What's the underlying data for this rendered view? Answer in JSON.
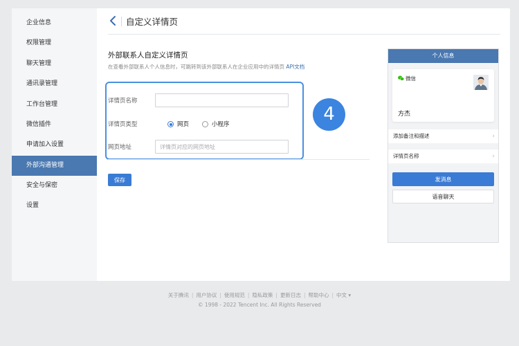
{
  "sidebar": {
    "items": [
      {
        "label": "企业信息"
      },
      {
        "label": "权限管理"
      },
      {
        "label": "聊天管理"
      },
      {
        "label": "通讯录管理"
      },
      {
        "label": "工作台管理"
      },
      {
        "label": "微信插件"
      },
      {
        "label": "申请加入设置"
      },
      {
        "label": "外部沟通管理",
        "active": true
      },
      {
        "label": "安全与保密"
      },
      {
        "label": "设置"
      }
    ]
  },
  "header": {
    "title": "自定义详情页"
  },
  "section": {
    "title": "外部联系人自定义详情页",
    "description": "在查看外部联系人个人信息时，可跳转到该外部联系人在企业应用中的详情页",
    "api_link": "API文档"
  },
  "form": {
    "name_label": "详情页名称",
    "name_value": "",
    "type_label": "详情页类型",
    "type_options": [
      {
        "label": "网页",
        "checked": true
      },
      {
        "label": "小程序",
        "checked": false
      }
    ],
    "url_label": "网页地址",
    "url_placeholder": "详情页对应的网页地址",
    "save_label": "保存"
  },
  "step_badge": "4",
  "preview": {
    "header": "个人信息",
    "wechat_label": "微信",
    "name": "方杰",
    "rows": [
      {
        "label": "添加备注和描述"
      },
      {
        "label": "详情页名称"
      }
    ],
    "send_label": "发消息",
    "voice_label": "语音聊天"
  },
  "footer": {
    "links": [
      "关于腾讯",
      "用户协议",
      "使用规范",
      "隐私政策",
      "更新日志",
      "帮助中心",
      "中文 ▾"
    ],
    "copyright": "© 1998 - 2022 Tencent Inc. All Rights Reserved"
  },
  "colors": {
    "accent": "#3a7bd5",
    "sidebar_active": "#4a78b0",
    "highlight_border": "#4a8fe0",
    "wechat_green": "#2dc100"
  },
  "icons": {
    "back": "chevron-left-icon",
    "wechat": "wechat-icon",
    "row_chevron": "chevron-right-icon"
  }
}
